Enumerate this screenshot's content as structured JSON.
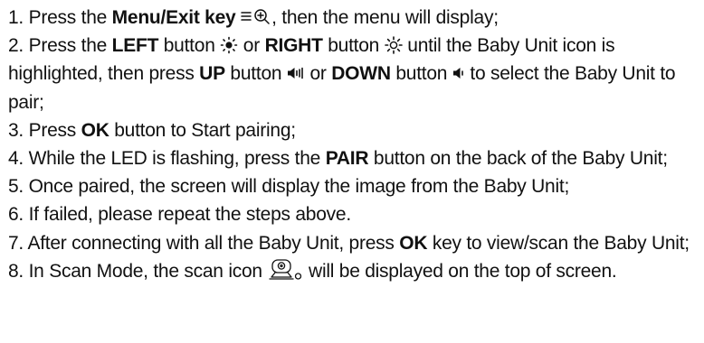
{
  "steps": [
    {
      "n": "1.",
      "s0": " Press the ",
      "k0": "Menu/Exit key",
      "s1": ", then the menu will display;"
    },
    {
      "n": "2.",
      "s0": " Press the ",
      "k0": "LEFT",
      "s1": " button ",
      "s2": " or ",
      "k1": "RIGHT",
      "s3": " button ",
      "s4": " until the Baby Unit icon is highlighted, then press ",
      "k2": "UP",
      "s5": " button ",
      "s6": " or ",
      "k3": "DOWN",
      "s7": " button ",
      "s8": " to select the Baby Unit to pair;"
    },
    {
      "n": "3.",
      "s0": " Press ",
      "k0": "OK",
      "s1": " button to Start pairing;"
    },
    {
      "n": "4.",
      "s0": " While the LED is flashing, press the ",
      "k0": "PAIR",
      "s1": " button on the back of the Baby Unit;"
    },
    {
      "n": "5.",
      "s0": " Once paired, the screen will display the image from the Baby Unit;"
    },
    {
      "n": "6.",
      "s0": " If failed, please repeat the steps above."
    },
    {
      "n": "7.",
      "s0": " After connecting with all the Baby Unit, press ",
      "k0": "OK",
      "s1": " key to view/scan the Baby Unit;"
    },
    {
      "n": "8.",
      "s0": " In Scan Mode, the scan icon ",
      "s1": " will be displayed on the top of screen."
    }
  ],
  "icons": {
    "menu": "menu-zoom-icon",
    "left": "brightness-down-icon",
    "right": "brightness-up-icon",
    "up": "volume-up-icon",
    "down": "volume-down-icon",
    "scan": "scan-camera-icon"
  }
}
